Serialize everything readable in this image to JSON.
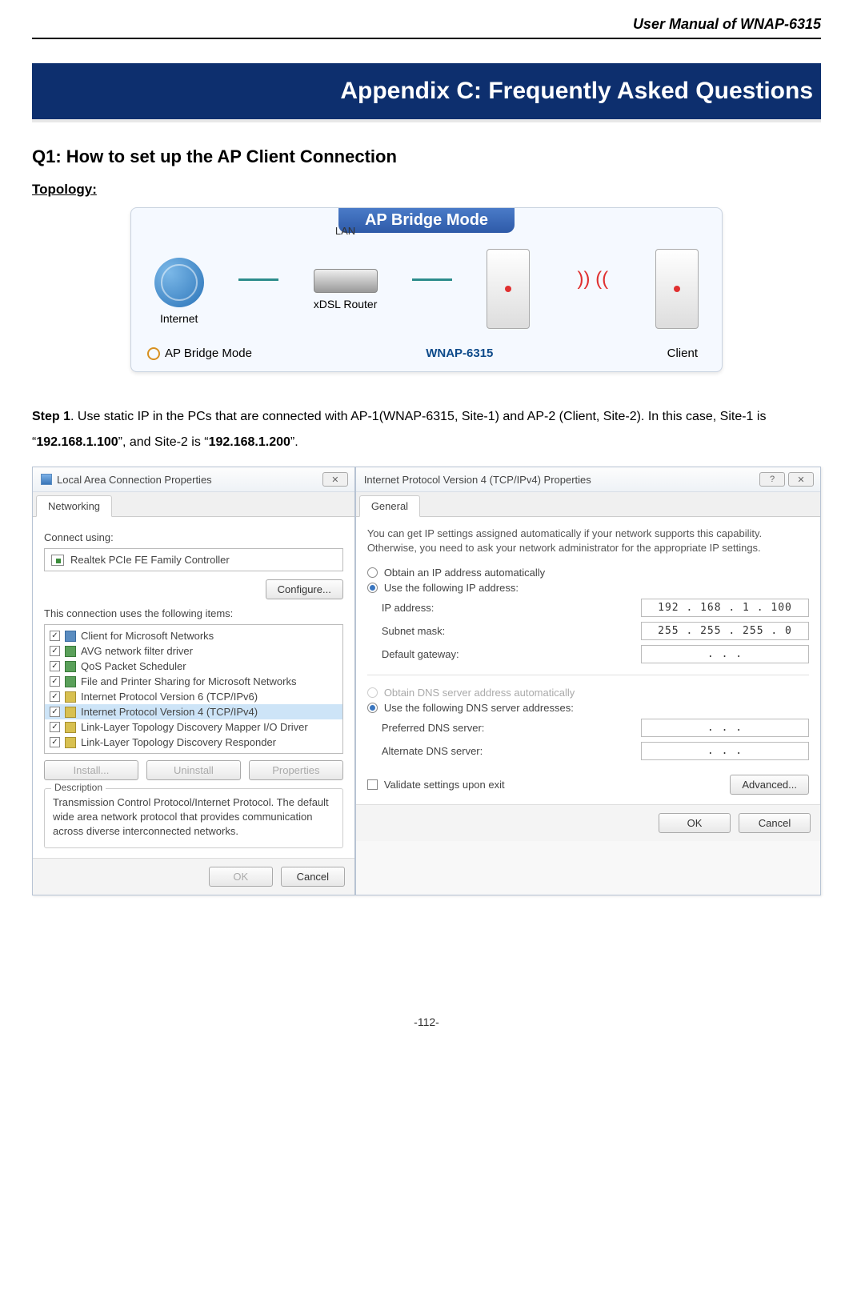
{
  "header": {
    "title": "User Manual of WNAP-6315"
  },
  "appendix": {
    "title": "Appendix C: Frequently Asked Questions"
  },
  "q1": {
    "title": "Q1: How to set up the AP Client Connection",
    "topology_label": "Topology:"
  },
  "topology": {
    "banner": "AP Bridge Mode",
    "internet": "Internet",
    "lan": "LAN",
    "router": "xDSL Router",
    "device": "WNAP-6315",
    "client": "Client",
    "mode_label": "AP Bridge Mode"
  },
  "step1": {
    "lead": "Step 1",
    "body_a": ". Use static IP in the PCs that are connected with AP-1(WNAP-6315, Site-1) and AP-2 (Client, Site-2). In this case, Site-1 is “",
    "ip1": "192.168.1.100",
    "body_b": "”, and Site-2 is “",
    "ip2": "192.168.1.200",
    "body_c": "”."
  },
  "dlg_lac": {
    "title": "Local Area Connection Properties",
    "tab": "Networking",
    "connect_using": "Connect using:",
    "adapter": "Realtek PCIe FE Family Controller",
    "configure": "Configure...",
    "items_label": "This connection uses the following items:",
    "items": [
      "Client for Microsoft Networks",
      "AVG network filter driver",
      "QoS Packet Scheduler",
      "File and Printer Sharing for Microsoft Networks",
      "Internet Protocol Version 6 (TCP/IPv6)",
      "Internet Protocol Version 4 (TCP/IPv4)",
      "Link-Layer Topology Discovery Mapper I/O Driver",
      "Link-Layer Topology Discovery Responder"
    ],
    "install": "Install...",
    "uninstall": "Uninstall",
    "properties": "Properties",
    "desc_label": "Description",
    "desc_text": "Transmission Control Protocol/Internet Protocol. The default wide area network protocol that provides communication across diverse interconnected networks.",
    "ok": "OK",
    "cancel": "Cancel"
  },
  "dlg_ipv4": {
    "title": "Internet Protocol Version 4 (TCP/IPv4) Properties",
    "tab": "General",
    "info": "You can get IP settings assigned automatically if your network supports this capability. Otherwise, you need to ask your network administrator for the appropriate IP settings.",
    "r_auto_ip": "Obtain an IP address automatically",
    "r_use_ip": "Use the following IP address:",
    "lbl_ip": "IP address:",
    "val_ip": "192 . 168 .  1  . 100",
    "lbl_mask": "Subnet mask:",
    "val_mask": "255 . 255 . 255 .  0",
    "lbl_gw": "Default gateway:",
    "val_gw": ".       .       .",
    "r_auto_dns": "Obtain DNS server address automatically",
    "r_use_dns": "Use the following DNS server addresses:",
    "lbl_pdns": "Preferred DNS server:",
    "val_pdns": ".       .       .",
    "lbl_adns": "Alternate DNS server:",
    "val_adns": ".       .       .",
    "validate": "Validate settings upon exit",
    "advanced": "Advanced...",
    "ok": "OK",
    "cancel": "Cancel"
  },
  "footer": {
    "page": "-112-"
  }
}
